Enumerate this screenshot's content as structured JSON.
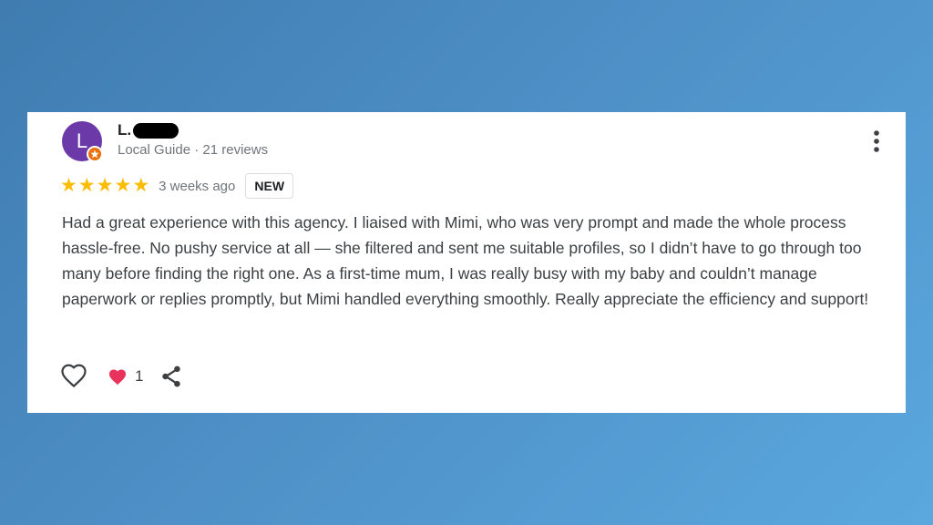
{
  "colors": {
    "avatar": "#6b3aa8",
    "guide_badge": "#e8710a",
    "star": "#fbbc04",
    "heart": "#e8335d",
    "background_start": "#3f7cb0",
    "background_end": "#5aa8de"
  },
  "review": {
    "author": {
      "initial": "L",
      "name": "L.",
      "meta": "Local Guide · 21 reviews",
      "badge_icon": "local-guide-badge-icon"
    },
    "rating": 5,
    "date": "3 weeks ago",
    "badge": "NEW",
    "text": "Had a great experience with this agency. I liaised with Mimi, who was very prompt and made the whole process hassle-free. No pushy service at all — she filtered and sent me suitable profiles, so I didn’t have to go through too many before finding the right one. As a first-time mum, I was really busy with my baby and couldn’t manage paperwork or replies promptly, but Mimi handled everything smoothly. Really appreciate the efficiency and support!",
    "actions": {
      "like_icon": "heart-outline-icon",
      "reaction_icon": "heart-filled-icon",
      "reaction_count": "1",
      "share_icon": "share-icon",
      "more_icon": "more-vertical-icon"
    }
  }
}
